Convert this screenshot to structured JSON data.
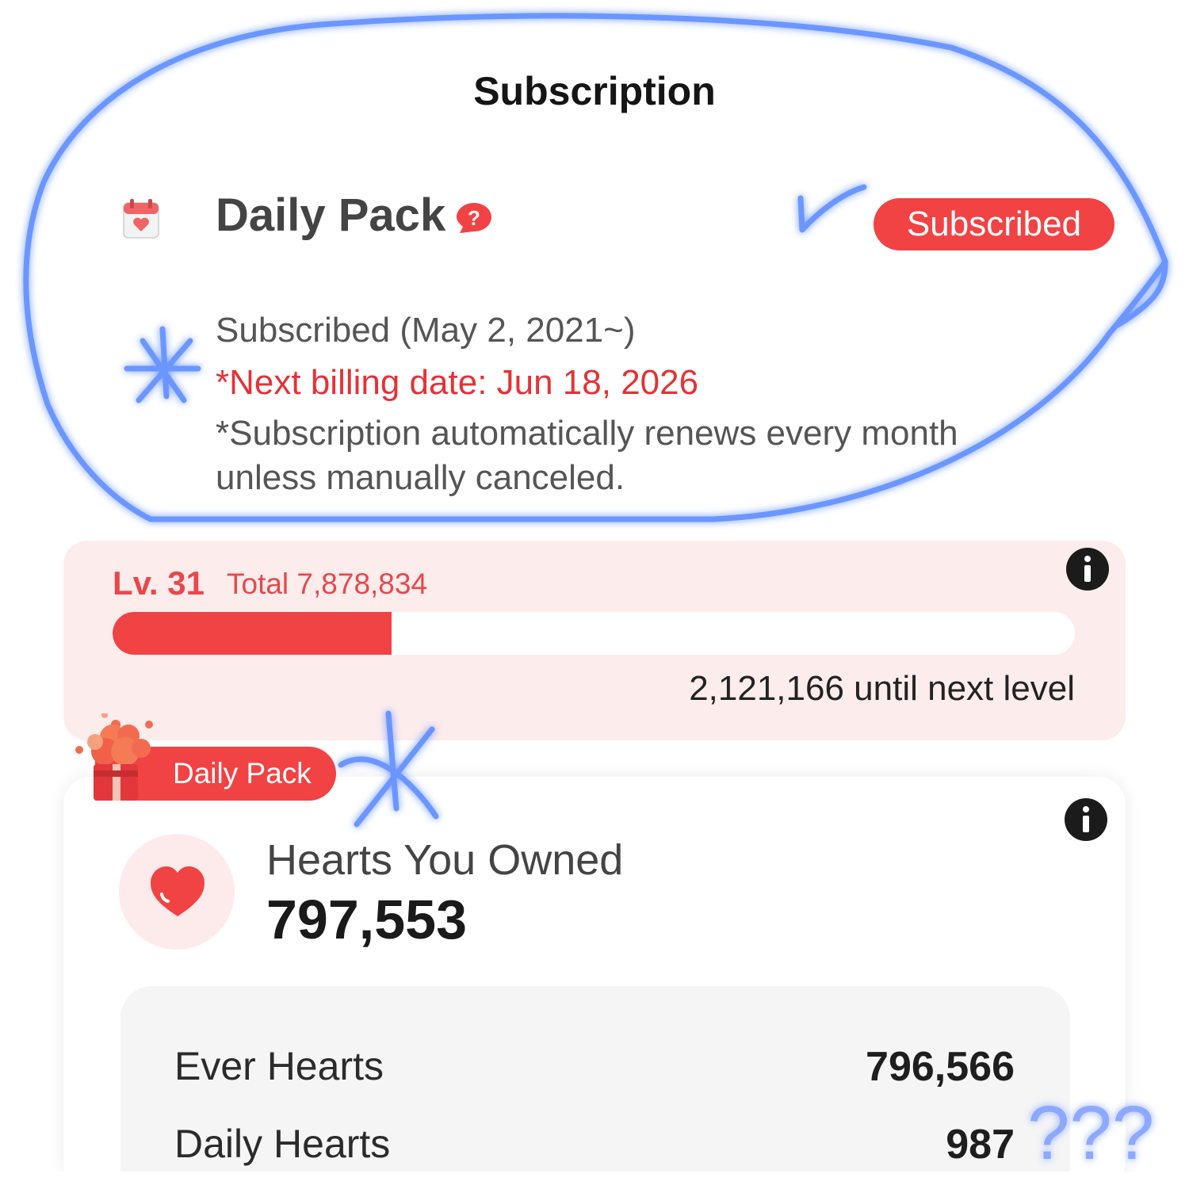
{
  "header": {
    "title": "Subscription"
  },
  "subscription": {
    "pack_name": "Daily Pack",
    "status_button": "Subscribed",
    "subscribed_since": "Subscribed (May 2, 2021~)",
    "next_billing": "*Next billing date: Jun 18, 2026",
    "note_line1": "*Subscription automatically renews every month",
    "note_line2": "unless manually canceled."
  },
  "level": {
    "level_label": "Lv. 31",
    "total": "Total 7,878,834",
    "progress_fraction": 0.29,
    "until_next": "2,121,166 until next level"
  },
  "hearts": {
    "tag_label": "Daily Pack",
    "owned_label": "Hearts You Owned",
    "owned_value": "797,553",
    "rows": [
      {
        "label": "Ever Hearts",
        "value": "796,566"
      },
      {
        "label": "Daily Hearts",
        "value": "987"
      }
    ]
  },
  "annotations": {
    "question_marks": "???"
  },
  "colors": {
    "accent": "#f14344",
    "annotation_blue": "#5b8bff",
    "level_bg": "#fdecec"
  },
  "icons": {
    "calendar": "calendar-heart-icon",
    "help": "question-bubble-icon",
    "info": "info-circle-icon",
    "gift": "gift-hearts-icon",
    "heart": "heart-icon"
  }
}
